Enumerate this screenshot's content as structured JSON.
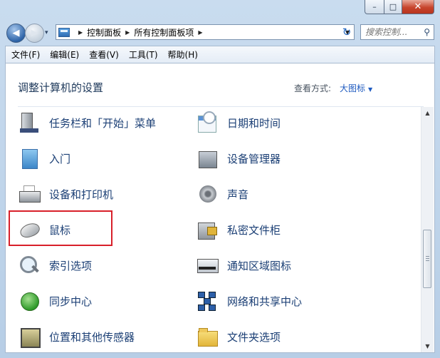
{
  "window": {
    "caption_buttons": {
      "minimize": "–",
      "maximize": "□",
      "close": "✕"
    }
  },
  "nav": {
    "back_glyph": "◀",
    "forward_glyph": "▶",
    "history_glyph": "▾",
    "breadcrumbs": [
      "控制面板",
      "所有控制面板项"
    ],
    "refresh_glyph": "↻",
    "search_placeholder": "搜索控制..."
  },
  "menu": [
    "文件(F)",
    "编辑(E)",
    "查看(V)",
    "工具(T)",
    "帮助(H)"
  ],
  "content": {
    "heading": "调整计算机的设置",
    "view_label": "查看方式:",
    "view_value": "大图标",
    "items_left": [
      {
        "label": "任务栏和「开始」菜单",
        "icon": "taskbar-icon"
      },
      {
        "label": "入门",
        "icon": "getting-started-icon"
      },
      {
        "label": "设备和打印机",
        "icon": "printer-icon"
      },
      {
        "label": "鼠标",
        "icon": "mouse-icon"
      },
      {
        "label": "索引选项",
        "icon": "indexing-icon"
      },
      {
        "label": "同步中心",
        "icon": "sync-icon"
      },
      {
        "label": "位置和其他传感器",
        "icon": "location-sensor-icon"
      }
    ],
    "items_right": [
      {
        "label": "日期和时间",
        "icon": "calendar-clock-icon"
      },
      {
        "label": "设备管理器",
        "icon": "device-manager-icon"
      },
      {
        "label": "声音",
        "icon": "speaker-icon"
      },
      {
        "label": "私密文件柜",
        "icon": "credential-locker-icon"
      },
      {
        "label": "通知区域图标",
        "icon": "notification-tray-icon"
      },
      {
        "label": "网络和共享中心",
        "icon": "network-icon"
      },
      {
        "label": "文件夹选项",
        "icon": "folder-icon"
      }
    ],
    "highlighted_item": "鼠标",
    "highlight_color": "#d8202a"
  },
  "scrollbar": {
    "up_glyph": "▲",
    "down_glyph": "▼"
  }
}
